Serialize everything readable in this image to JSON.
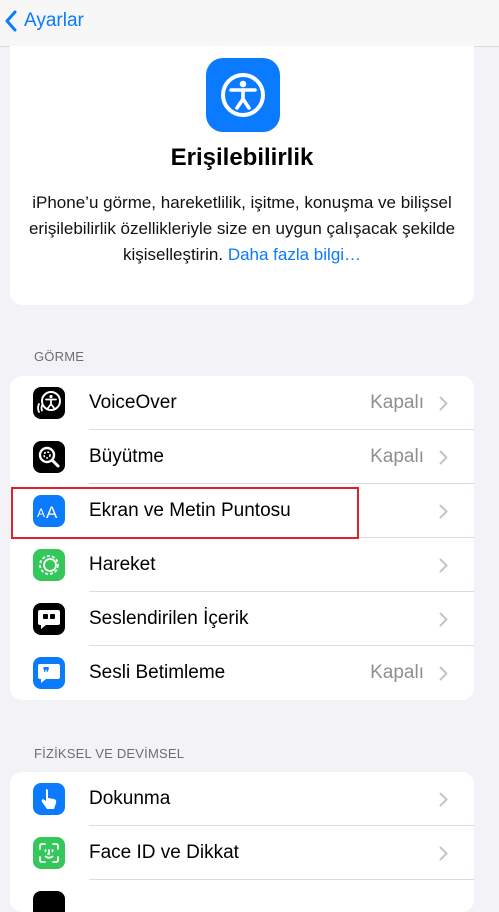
{
  "nav": {
    "back_label": "Ayarlar"
  },
  "hero": {
    "title": "Erişilebilirlik",
    "description": "iPhone’u görme, hareketlilik, işitme, konuşma ve bilişsel erişilebilirlik özellikleriyle size en uygun çalışacak şekilde kişiselleştirin.",
    "link": "Daha fazla bilgi…"
  },
  "sections": {
    "vision": {
      "header": "GÖRME",
      "items": [
        {
          "label": "VoiceOver",
          "value": "Kapalı",
          "icon": "voiceover-icon",
          "color": "#000000"
        },
        {
          "label": "Büyütme",
          "value": "Kapalı",
          "icon": "zoom-icon",
          "color": "#000000"
        },
        {
          "label": "Ekran ve Metin Puntosu",
          "value": "",
          "icon": "text-size-icon",
          "color": "#0a7aff"
        },
        {
          "label": "Hareket",
          "value": "",
          "icon": "motion-icon",
          "color": "#34c759"
        },
        {
          "label": "Seslendirilen İçerik",
          "value": "",
          "icon": "spoken-content-icon",
          "color": "#000000"
        },
        {
          "label": "Sesli Betimleme",
          "value": "Kapalı",
          "icon": "audio-description-icon",
          "color": "#0a7aff"
        }
      ]
    },
    "physical": {
      "header": "FİZİKSEL VE DEVİMSEL",
      "items": [
        {
          "label": "Dokunma",
          "value": "",
          "icon": "touch-icon",
          "color": "#0a7aff"
        },
        {
          "label": "Face ID ve Dikkat",
          "value": "",
          "icon": "face-id-icon",
          "color": "#34c759"
        }
      ]
    }
  }
}
